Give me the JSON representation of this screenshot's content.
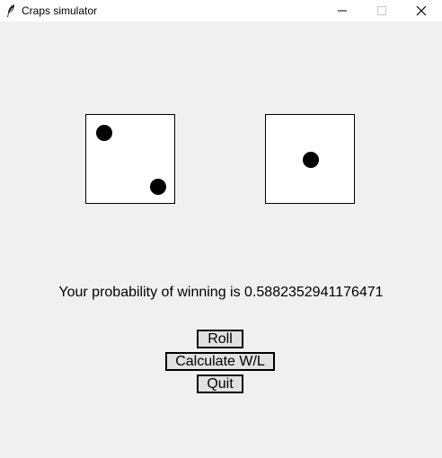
{
  "window": {
    "title": "Craps simulator",
    "icon": "feather-icon",
    "controls": [
      "minimize-icon",
      "maximize-icon",
      "close-icon"
    ]
  },
  "dice": [
    {
      "name": "die-left",
      "value": 2
    },
    {
      "name": "die-right",
      "value": 1
    }
  ],
  "result": {
    "text": "Your probability of winning is 0.5882352941176471"
  },
  "buttons": {
    "roll_label": "Roll",
    "calculate_label": "Calculate W/L",
    "quit_label": "Quit"
  }
}
